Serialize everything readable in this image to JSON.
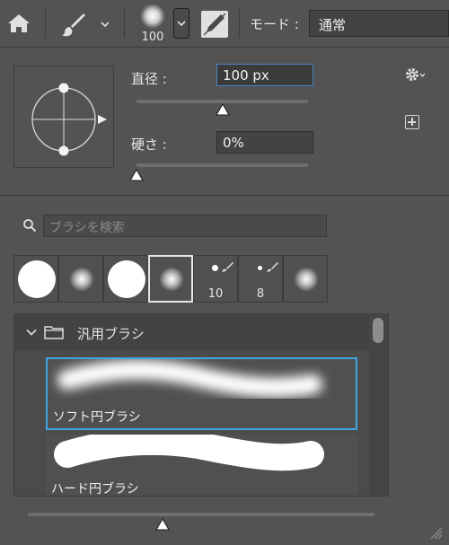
{
  "options_bar": {
    "home_icon": "home-icon",
    "brush_tool_icon": "brush-icon",
    "brush_size": "100",
    "pen_pressure_icon": "pen-pressure-icon",
    "mode_label": "モード :",
    "mode_value": "通常"
  },
  "panel": {
    "size_label": "直径 :",
    "size_value": "100 px",
    "size_percent": 0.5,
    "hardness_label": "硬さ :",
    "hardness_value": "0%",
    "hardness_percent": 0.0,
    "gear_icon": "gear-icon",
    "new_preset_icon": "new-preset-icon",
    "search_placeholder": "ブラシを検索",
    "recent_brushes": [
      {
        "kind": "hard",
        "label": ""
      },
      {
        "kind": "soft",
        "label": ""
      },
      {
        "kind": "hard",
        "label": ""
      },
      {
        "kind": "soft",
        "label": "",
        "selected": true
      },
      {
        "kind": "small-hard",
        "label": "10"
      },
      {
        "kind": "small-hard",
        "label": "8"
      },
      {
        "kind": "soft",
        "label": ""
      }
    ],
    "group_name": "汎用ブラシ",
    "brushes": [
      {
        "name": "ソフト円ブラシ",
        "selected": true
      },
      {
        "name": "ハード円ブラシ",
        "selected": false
      }
    ]
  },
  "colors": {
    "background": "#535353",
    "selection_blue": "#3fa5e6",
    "active_field_border": "#4a84c4"
  }
}
